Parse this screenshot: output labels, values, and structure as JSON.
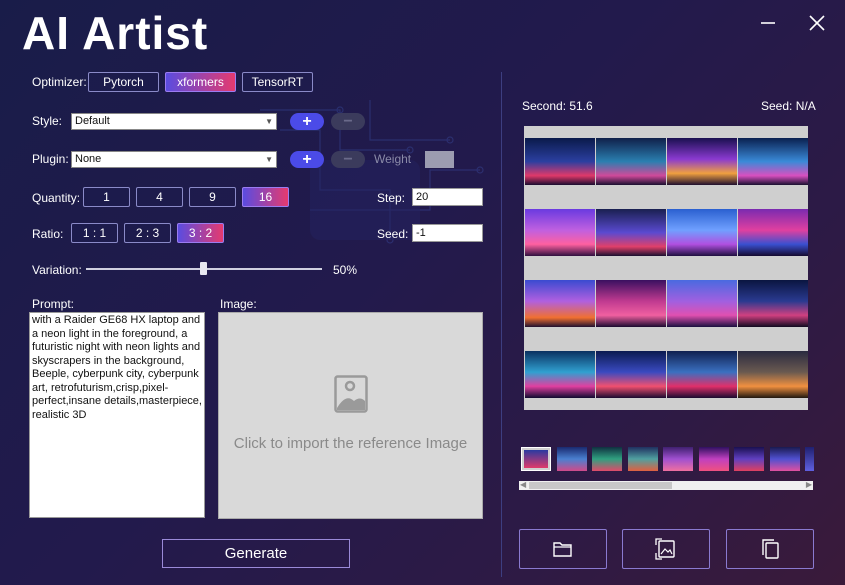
{
  "app": {
    "title": "AI Artist"
  },
  "window": {
    "minimize_icon": "minimize-icon",
    "close_icon": "close-icon"
  },
  "optimizer": {
    "label": "Optimizer:",
    "options": [
      "Pytorch",
      "xformers",
      "TensorRT"
    ],
    "selected": "xformers"
  },
  "style": {
    "label": "Style:",
    "value": "Default"
  },
  "plugin": {
    "label": "Plugin:",
    "value": "None",
    "weight_label": "Weight"
  },
  "quantity": {
    "label": "Quantity:",
    "options": [
      "1",
      "4",
      "9",
      "16"
    ],
    "selected": "16"
  },
  "step": {
    "label": "Step:",
    "value": "20"
  },
  "ratio": {
    "label": "Ratio:",
    "options": [
      "1 : 1",
      "2 : 3",
      "3 : 2"
    ],
    "selected": "3 : 2"
  },
  "seed_input": {
    "label": "Seed:",
    "value": "-1"
  },
  "variation": {
    "label": "Variation:",
    "value_text": "50%",
    "value": 0.5
  },
  "prompt": {
    "label": "Prompt:",
    "text": "with a Raider GE68 HX laptop and a neon light in the foreground, a futuristic night with neon lights and skyscrapers in the background, Beeple, cyberpunk city, cyberpunk art, retrofuturism,crisp,pixel-perfect,insane details,masterpiece, realistic 3D"
  },
  "image": {
    "label": "Image:",
    "placeholder": "Click to import the reference Image",
    "icon": "image-icon"
  },
  "generate": {
    "label": "Generate"
  },
  "result": {
    "second_text": "Second: 51.6",
    "seed_text": "Seed: N/A"
  },
  "actions": {
    "icons": [
      "folder-icon",
      "image-export-icon",
      "copy-icon"
    ]
  },
  "colors": {
    "accent_start": "#5a4ce0",
    "accent_end": "#e53a6f",
    "plus_button": "#4b4be8"
  }
}
